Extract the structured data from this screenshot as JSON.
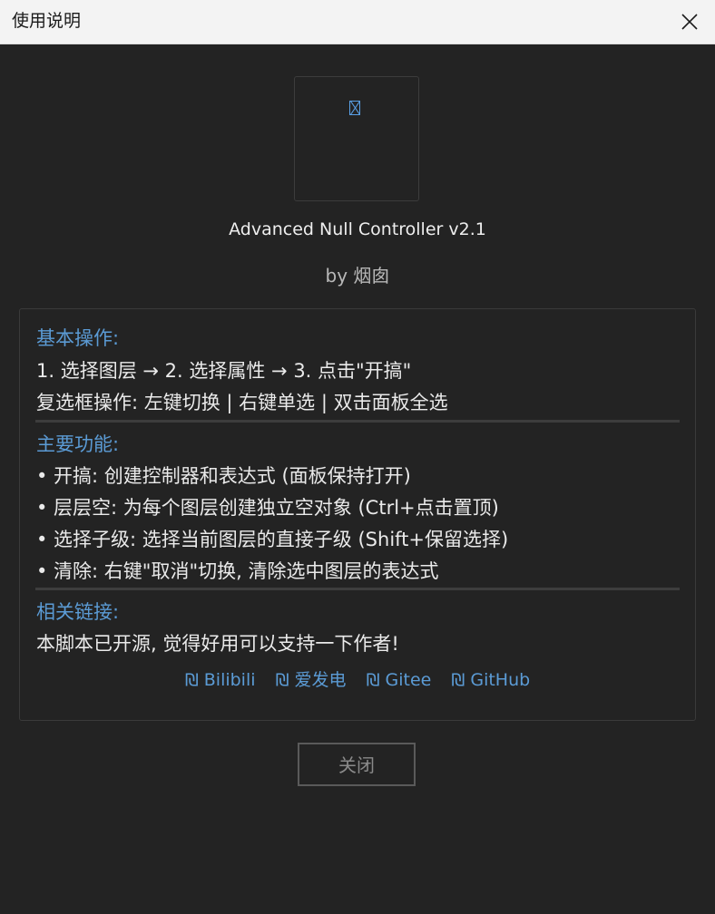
{
  "window": {
    "title": "使用说明",
    "close_icon": "close-icon"
  },
  "about": {
    "logo_icon": "missing-image-icon",
    "app_name": "Advanced Null Controller v2.1",
    "author": "by 烟囱"
  },
  "sections": {
    "basic": {
      "title": "基本操作:",
      "lines": [
        "1. 选择图层 → 2. 选择属性 → 3. 点击\"开搞\"",
        "复选框操作: 左键切换 | 右键单选 | 双击面板全选"
      ]
    },
    "features": {
      "title": "主要功能:",
      "lines": [
        "• 开搞: 创建控制器和表达式 (面板保持打开)",
        "• 层层空: 为每个图层创建独立空对象 (Ctrl+点击置顶)",
        "• 选择子级: 选择当前图层的直接子级 (Shift+保留选择)",
        "• 清除: 右键\"取消\"切换, 清除选中图层的表达式"
      ]
    },
    "links": {
      "title": "相关链接:",
      "note": "本脚本已开源, 觉得好用可以支持一下作者!",
      "items": [
        {
          "label": "₪ Bilibili"
        },
        {
          "label": "₪ 爱发电"
        },
        {
          "label": "₪ Gitee"
        },
        {
          "label": "₪ GitHub"
        }
      ]
    }
  },
  "footer": {
    "close_label": "关闭"
  },
  "colors": {
    "accent": "#5b9bd5",
    "background": "#232323",
    "titlebar": "#f3f3f3"
  }
}
